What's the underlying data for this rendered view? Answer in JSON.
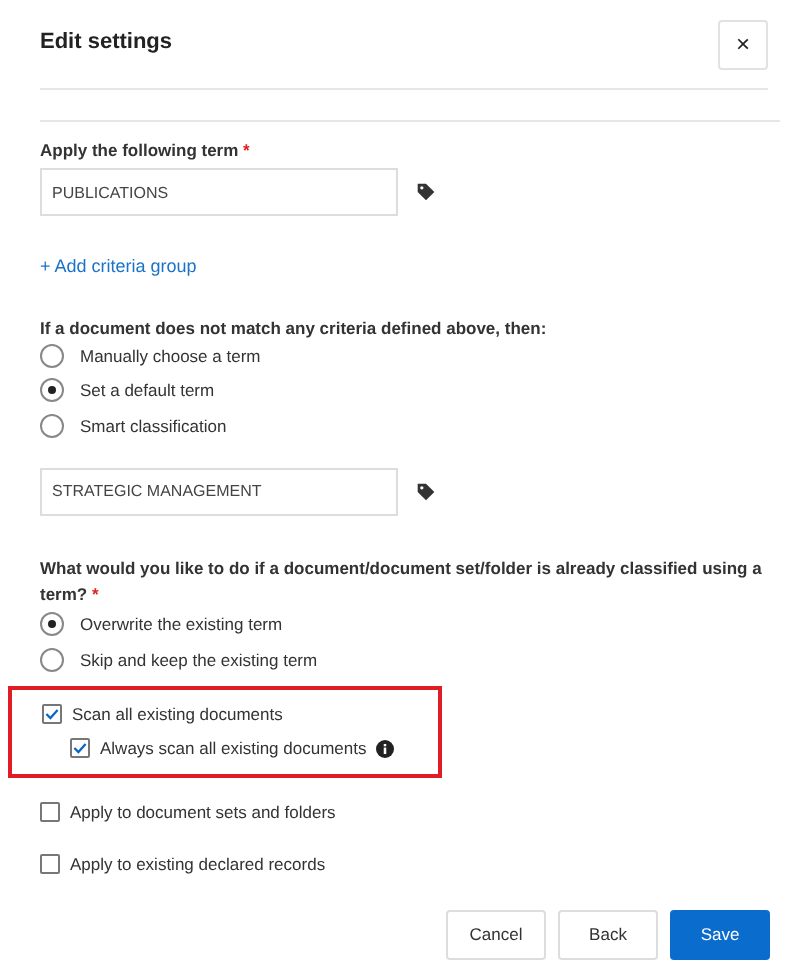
{
  "dialog": {
    "title": "Edit settings",
    "close": "×"
  },
  "term": {
    "label": "Apply the following term",
    "required": "*",
    "value": "PUBLICATIONS"
  },
  "add_link": "+ Add criteria group",
  "fallback": {
    "label": "If a document does not match any criteria defined above, then:",
    "options": [
      {
        "label": "Manually choose a term",
        "selected": false
      },
      {
        "label": "Set a default term",
        "selected": true
      },
      {
        "label": "Smart classification",
        "selected": false
      }
    ],
    "value": "STRATEGIC MANAGEMENT"
  },
  "existing": {
    "label": "What would you like to do if a document/document set/folder is already classified using a term?",
    "required": "*",
    "options": [
      {
        "label": "Overwrite the existing term",
        "selected": true
      },
      {
        "label": "Skip and keep the existing term",
        "selected": false
      }
    ]
  },
  "highlight": {
    "checkboxes": [
      {
        "label": "Scan all existing documents",
        "checked": true,
        "info": false,
        "children": [
          {
            "label": "Always scan all existing documents",
            "checked": true,
            "info": true
          }
        ]
      }
    ]
  },
  "checkboxes": [
    {
      "label": "Apply to document sets and folders",
      "checked": false
    },
    {
      "label": "Apply to existing declared records",
      "checked": false
    }
  ],
  "buttons": [
    {
      "label": "Cancel",
      "kind": "secondary"
    },
    {
      "label": "Back",
      "kind": "secondary"
    },
    {
      "label": "Save",
      "kind": "primary"
    }
  ]
}
